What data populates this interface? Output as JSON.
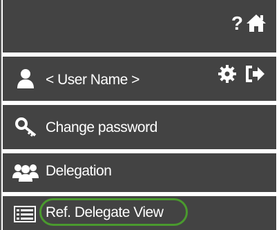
{
  "toolbar": {
    "help_icon": "question-mark-icon",
    "help_symbol": "?",
    "home_icon": "home-icon"
  },
  "user": {
    "icon": "user-icon",
    "label": "< User Name >",
    "settings_icon": "gear-icon",
    "logout_icon": "sign-out-icon"
  },
  "menu": {
    "change_password": {
      "icon": "key-icon",
      "label": "Change password"
    },
    "delegation": {
      "icon": "users-group-icon",
      "label": "Delegation"
    },
    "ref_delegate_view": {
      "icon": "list-icon",
      "label": "Ref. Delegate View",
      "highlighted": true
    }
  },
  "colors": {
    "row_background": "#434343",
    "text": "#ffffff",
    "highlight": "#4a9a2e",
    "separator": "#ffffff"
  }
}
